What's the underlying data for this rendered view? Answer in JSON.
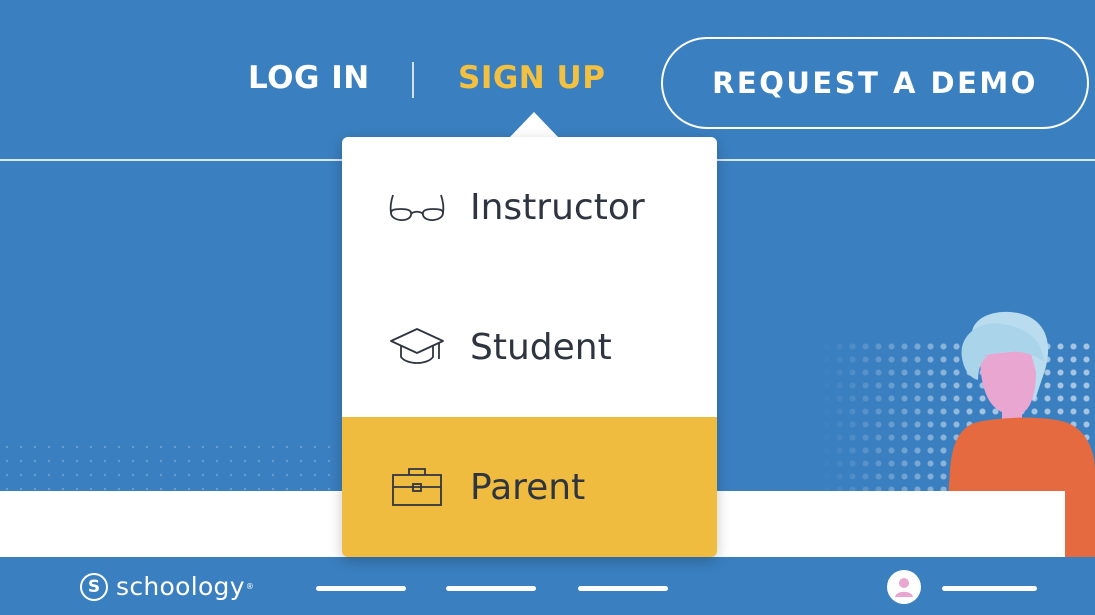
{
  "nav": {
    "login_label": "LOG IN",
    "separator": "|",
    "signup_label": "SIGN UP",
    "demo_label": "REQUEST A DEMO"
  },
  "dropdown": {
    "items": [
      {
        "label": "Instructor",
        "icon": "glasses-icon"
      },
      {
        "label": "Student",
        "icon": "graduation-cap-icon"
      },
      {
        "label": "Parent",
        "icon": "briefcase-icon",
        "highlighted": true
      }
    ]
  },
  "footer": {
    "logo_mark": "S",
    "logo_text": "schoology",
    "logo_tm": "®"
  },
  "colors": {
    "background": "#3a7fc0",
    "accent": "#f3c13f",
    "highlight": "#efbc3f",
    "text_dark": "#2f3540"
  }
}
